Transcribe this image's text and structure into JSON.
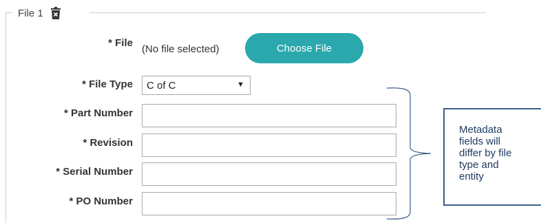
{
  "fieldset": {
    "legend": "File 1",
    "delete_icon": "trash-icon"
  },
  "file": {
    "label": "* File",
    "status": "(No file selected)",
    "button_label": "Choose File",
    "button_color": "#2aa8ad"
  },
  "file_type": {
    "label": "* File Type",
    "selected": "C of C",
    "arrow": "▼"
  },
  "fields": [
    {
      "label": "* Part Number",
      "value": ""
    },
    {
      "label": "* Revision",
      "value": ""
    },
    {
      "label": "* Serial Number",
      "value": ""
    },
    {
      "label": "* PO Number",
      "value": ""
    }
  ],
  "callout": {
    "lines": [
      "Metadata",
      "fields will",
      "differ by file",
      "type and",
      "entity"
    ],
    "border_color": "#3d5d8a"
  }
}
